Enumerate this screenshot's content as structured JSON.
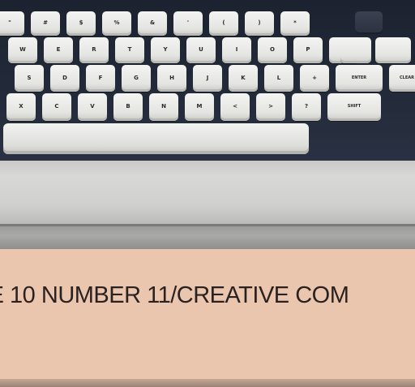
{
  "footer": {
    "text": "ME 10 NUMBER 11/CREATIVE COM"
  },
  "keyboard": {
    "rows": [
      [
        "\"",
        "#",
        "$",
        "%",
        "&",
        "'",
        "(",
        ")",
        "*"
      ],
      [
        "W",
        "E",
        "R",
        "T",
        "Y",
        "U",
        "I",
        "O",
        "P",
        "@"
      ],
      [
        "S",
        "D",
        "F",
        "G",
        "H",
        "J",
        "K",
        "L",
        "+",
        "ENTER",
        "CLEAR"
      ],
      [
        "X",
        "C",
        "V",
        "B",
        "N",
        "M",
        "<",
        ">",
        "?",
        "SHIFT"
      ]
    ]
  }
}
